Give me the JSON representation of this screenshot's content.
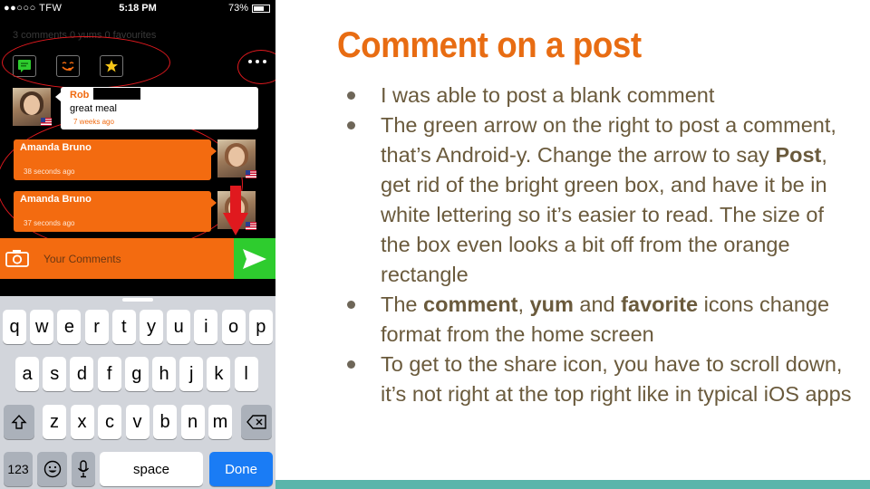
{
  "status_bar": {
    "carrier": "●●○○○ TFW",
    "time": "5:18 PM",
    "battery": "73%",
    "battery_level": 0.73
  },
  "post": {
    "counts": "3 comments 0 yums 0 favourites"
  },
  "comments": [
    {
      "author": "Rob",
      "text": "great meal",
      "time": "7 weeks ago",
      "style": "received"
    },
    {
      "author": "Amanda Bruno",
      "time": "38 seconds ago",
      "style": "sent"
    },
    {
      "author": "Amanda Bruno",
      "time": "37 seconds ago",
      "style": "sent"
    }
  ],
  "composer": {
    "placeholder": "Your Comments"
  },
  "keyboard": {
    "row1": [
      "q",
      "w",
      "e",
      "r",
      "t",
      "y",
      "u",
      "i",
      "o",
      "p"
    ],
    "row2": [
      "a",
      "s",
      "d",
      "f",
      "g",
      "h",
      "j",
      "k",
      "l"
    ],
    "row3": [
      "z",
      "x",
      "c",
      "v",
      "b",
      "n",
      "m"
    ],
    "numbers_key": "123",
    "space_key": "space",
    "done_key": "Done"
  },
  "slide": {
    "title": "Comment on a post",
    "bullets": [
      [
        {
          "t": "I was able to post a blank comment",
          "b": false
        }
      ],
      [
        {
          "t": "The green arrow on the right to post a comment, that’s Android-y. Change the arrow to say ",
          "b": false
        },
        {
          "t": "Post",
          "b": true
        },
        {
          "t": ", get rid of the bright green box, and have it be in white lettering so it’s easier to read. The size of the box even looks a bit off from the orange rectangle",
          "b": false
        }
      ],
      [
        {
          "t": "The ",
          "b": false
        },
        {
          "t": "comment",
          "b": true
        },
        {
          "t": ", ",
          "b": false
        },
        {
          "t": "yum",
          "b": true
        },
        {
          "t": " and ",
          "b": false
        },
        {
          "t": "favorite",
          "b": true
        },
        {
          "t": " icons change format from the home screen",
          "b": false
        }
      ],
      [
        {
          "t": "To get to the share icon, you have to scroll down, it’s not right at the top right like in typical iOS apps",
          "b": false
        }
      ]
    ]
  },
  "colors": {
    "accent_orange": "#f36b10",
    "send_green": "#2ecc2e",
    "title_orange": "#e86c12",
    "body_text": "#6a5a3c",
    "annotation_red": "#e0191e",
    "footer_teal": "#5ab5ab",
    "ios_blue": "#1a7cf5"
  },
  "icons": {
    "comment": "comment-icon",
    "yum": "yum-icon",
    "favourite": "star-icon",
    "more": "more-icon",
    "camera": "camera-icon",
    "send": "send-arrow-icon",
    "shift": "shift-icon",
    "backspace": "backspace-icon",
    "emoji": "emoji-icon",
    "mic": "mic-icon"
  }
}
